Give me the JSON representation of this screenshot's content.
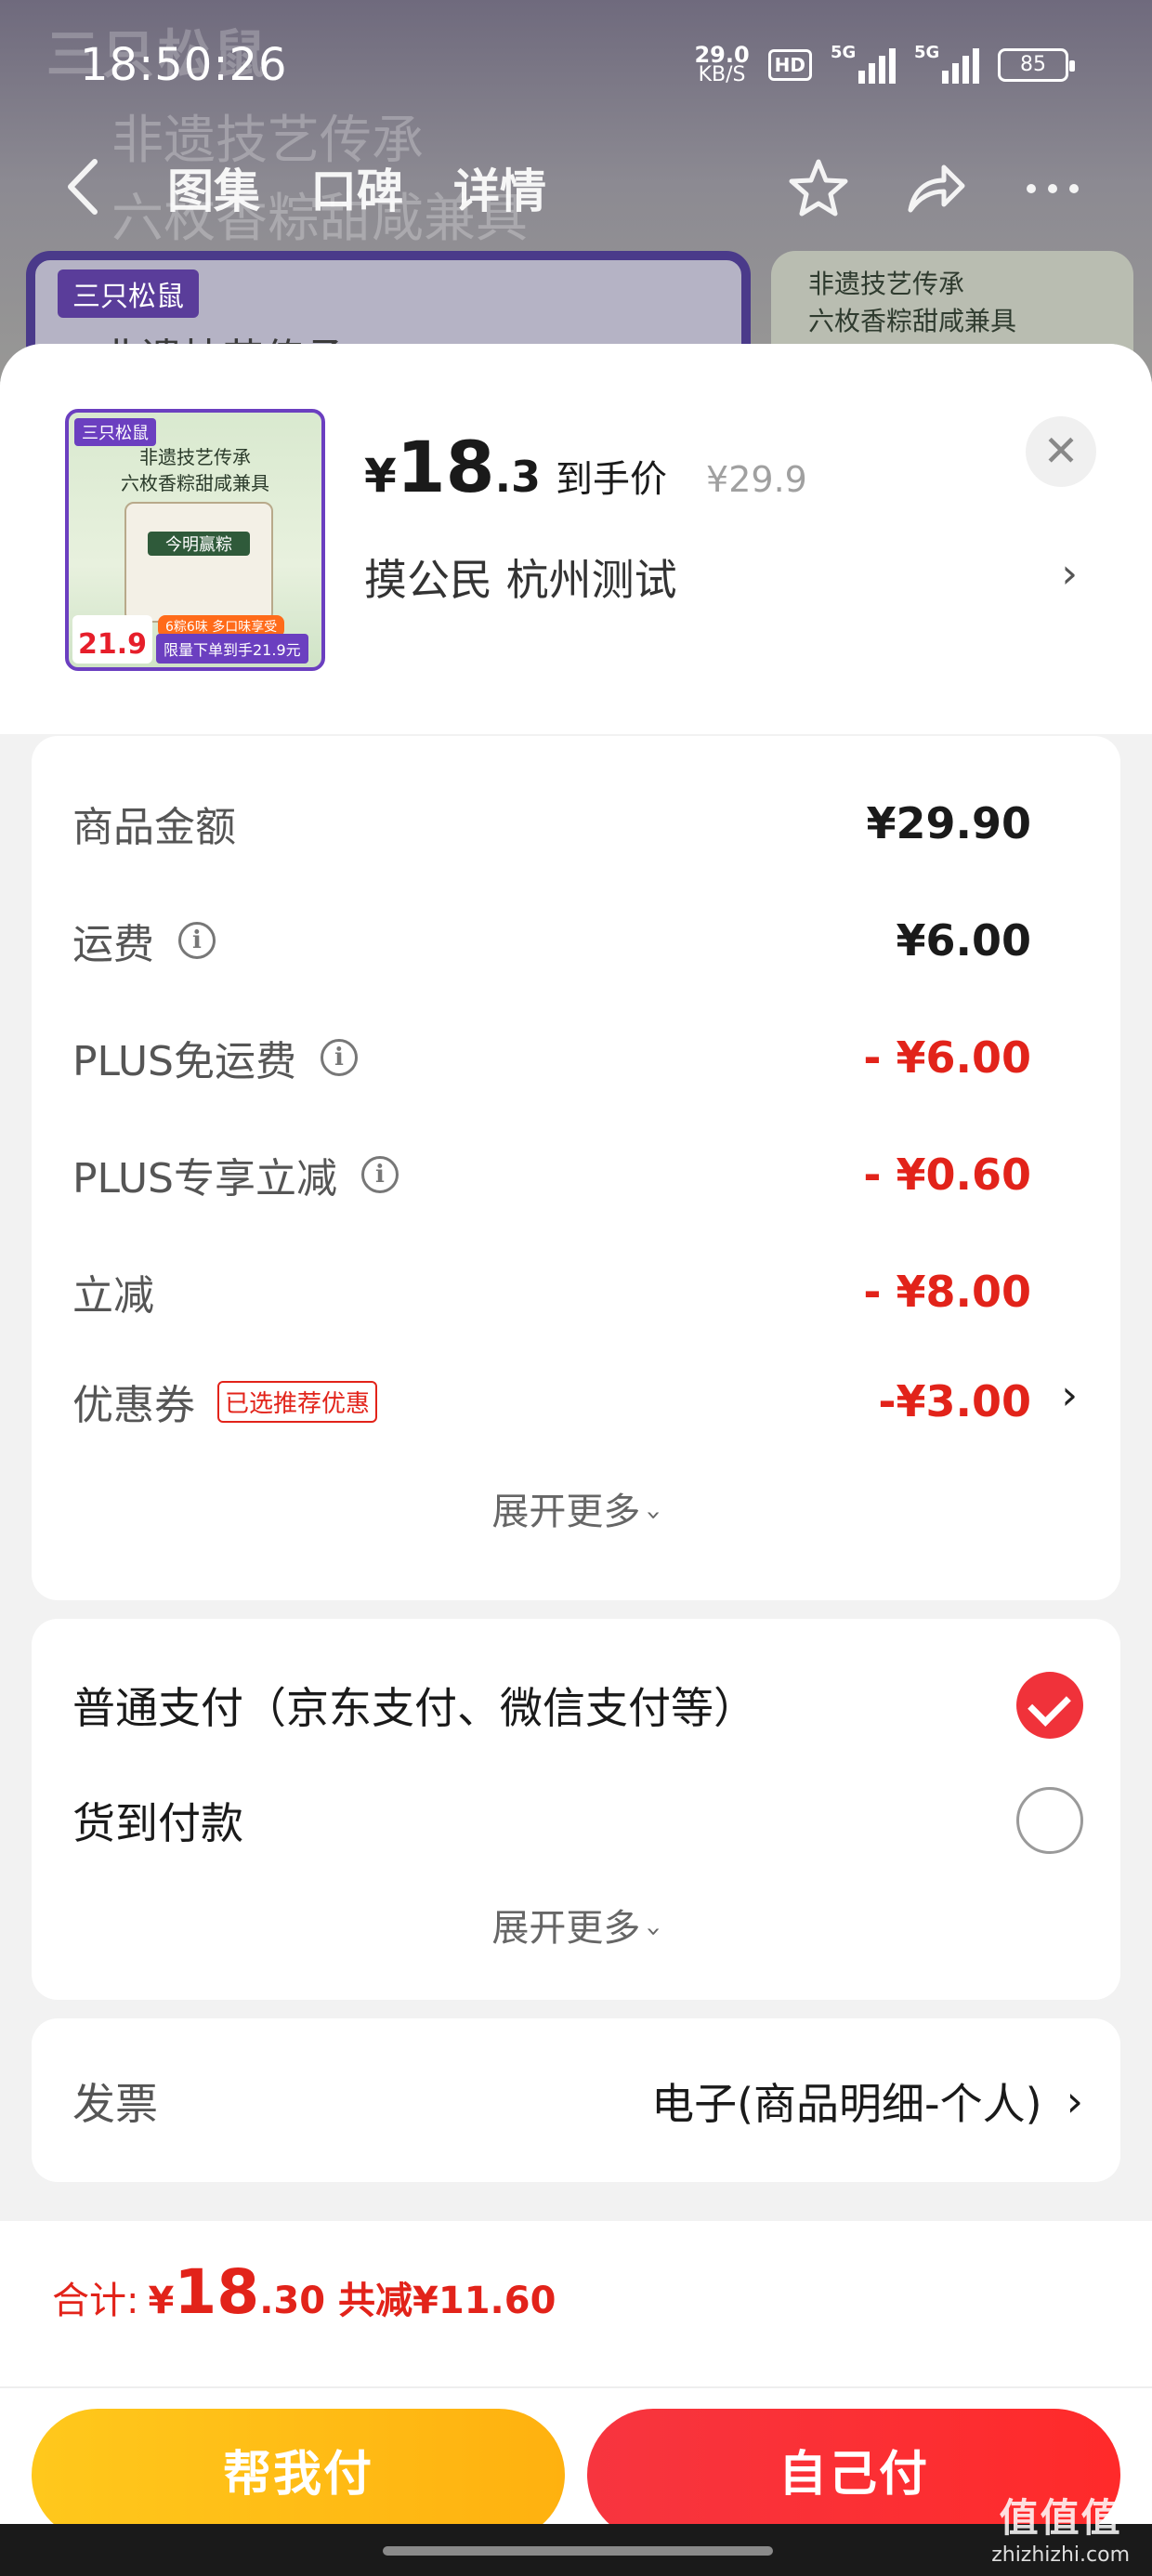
{
  "status_bar": {
    "time": "18:50:26",
    "net_speed_value": "29.0",
    "net_speed_unit": "KB/S",
    "hd": "HD",
    "signal1_gen": "5G",
    "signal2_gen": "5G",
    "battery": "85"
  },
  "background": {
    "brand": "三只松鼠",
    "slogan_line1": "非遗技艺传承",
    "slogan_line2": "六枚香粽甜咸兼具",
    "card_tag": "三只松鼠",
    "card_text": "非遗技艺传承",
    "right_card_line1": "非遗技艺传承",
    "right_card_line2": "六枚香粽甜咸兼具"
  },
  "nav": {
    "tabs": [
      "图集",
      "口碑",
      "详情"
    ],
    "icons": [
      "back-icon",
      "star-icon",
      "share-icon",
      "more-icon"
    ]
  },
  "product": {
    "thumb_brand": "三只松鼠",
    "thumb_slogan1": "非遗技艺传承",
    "thumb_slogan2": "六枚香粽甜咸兼具",
    "thumb_bag_label": "今明赢粽",
    "thumb_price": "21.9",
    "thumb_promo1": "6粽6味 多口味享受",
    "thumb_promo2": "限量下单到手21.9元",
    "price_symbol": "¥",
    "price_int": "18",
    "price_dec": ".3",
    "price_label": "到手价",
    "original_price": "¥29.9",
    "address": "摸公民  杭州测试"
  },
  "price_details": {
    "rows": [
      {
        "label": "商品金额",
        "value": "¥29.90"
      },
      {
        "label": "运费",
        "value": "¥6.00"
      },
      {
        "label": "PLUS免运费",
        "value": "- ¥6.00"
      },
      {
        "label": "PLUS专享立减",
        "value": "- ¥0.60"
      },
      {
        "label": "立减",
        "value": "- ¥8.00"
      },
      {
        "label": "优惠券",
        "badge": "已选推荐优惠",
        "value": "-¥3.00"
      }
    ],
    "expand_label": "展开更多"
  },
  "payment": {
    "options": [
      {
        "label": "普通支付（京东支付、微信支付等）",
        "selected": true
      },
      {
        "label": "货到付款",
        "selected": false
      }
    ],
    "expand_label": "展开更多"
  },
  "invoice": {
    "label": "发票",
    "value": "电子(商品明细-个人)"
  },
  "footer": {
    "total_label": "合计:",
    "total_symbol": "¥",
    "total_int": "18",
    "total_dec": ".30",
    "discount": "共减¥11.60",
    "help_pay": "帮我付",
    "self_pay": "自己付"
  },
  "watermark": {
    "logo": "值值值",
    "site": "zhizhizhi.com"
  },
  "colors": {
    "accent_red": "#e2231a",
    "pay_yellow": "#ffb10f",
    "pay_red": "#f7353f"
  }
}
